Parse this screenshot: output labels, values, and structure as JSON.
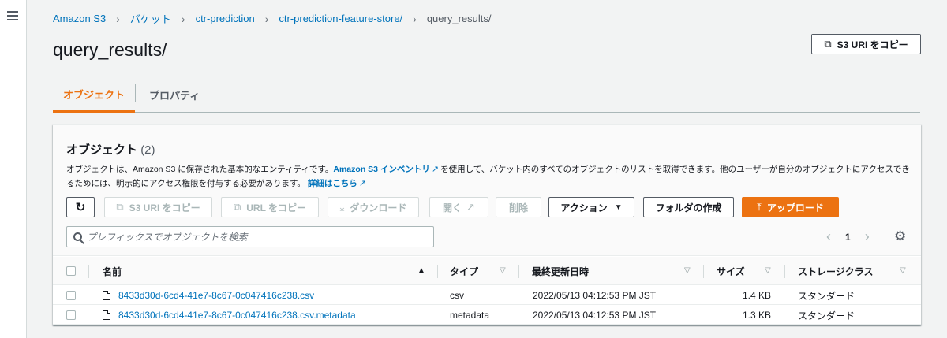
{
  "breadcrumb": {
    "items": [
      "Amazon S3",
      "バケット",
      "ctr-prediction",
      "ctr-prediction-feature-store/"
    ],
    "current": "query_results/"
  },
  "page": {
    "title": "query_results/",
    "copy_s3_uri_label": "S3 URI をコピー"
  },
  "tabs": [
    {
      "label": "オブジェクト"
    },
    {
      "label": "プロパティ"
    }
  ],
  "objects_panel": {
    "title": "オブジェクト",
    "count": "(2)",
    "desc_1": "オブジェクトは、Amazon S3 に保存された基本的なエンティティです。",
    "inventory_link": "Amazon S3 インベントリ",
    "desc_2": "を使用して、バケット内のすべてのオブジェクトのリストを取得できます。他のユーザーが自分のオブジェクトにアクセスできるためには、明示的にアクセス権限を付与する必要があります。",
    "details_link": "詳細はこちら"
  },
  "toolbar": {
    "copy_s3_uri": "S3 URI をコピー",
    "copy_url": "URL をコピー",
    "download": "ダウンロード",
    "open": "開く",
    "delete": "削除",
    "actions": "アクション",
    "create_folder": "フォルダの作成",
    "upload": "アップロード"
  },
  "search": {
    "placeholder": "プレフィックスでオブジェクトを検索"
  },
  "pagination": {
    "page": "1"
  },
  "table": {
    "columns": [
      "名前",
      "タイプ",
      "最終更新日時",
      "サイズ",
      "ストレージクラス"
    ],
    "rows": [
      {
        "name": "8433d30d-6cd4-41e7-8c67-0c047416c238.csv",
        "type": "csv",
        "modified": "2022/05/13 04:12:53 PM JST",
        "size": "1.4 KB",
        "storage": "スタンダード"
      },
      {
        "name": "8433d30d-6cd4-41e7-8c67-0c047416c238.csv.metadata",
        "type": "metadata",
        "modified": "2022/05/13 04:12:53 PM JST",
        "size": "1.3 KB",
        "storage": "スタンダード"
      }
    ]
  },
  "colors": {
    "accent": "#ec7211",
    "link": "#0073bb",
    "background": "#f2f3f3"
  },
  "icons": [
    "hamburger-icon",
    "chevron-right-icon",
    "copy-icon",
    "refresh-icon",
    "download-icon",
    "external-link-icon",
    "caret-down-icon",
    "upload-icon",
    "search-icon",
    "settings-gear-icon",
    "file-icon",
    "sort-icon"
  ]
}
